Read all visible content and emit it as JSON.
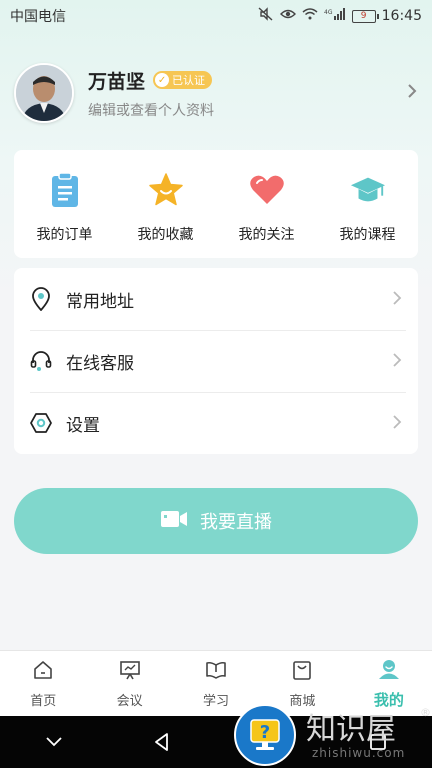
{
  "status_bar": {
    "carrier": "中国电信",
    "network": "4G",
    "battery": "9",
    "time": "16:45"
  },
  "profile": {
    "name": "万苗坚",
    "badge": "已认证",
    "subtitle": "编辑或查看个人资料"
  },
  "quick_actions": [
    {
      "label": "我的订单",
      "icon": "clipboard-icon",
      "color": "#5fb6e6"
    },
    {
      "label": "我的收藏",
      "icon": "star-icon",
      "color": "#f5b327"
    },
    {
      "label": "我的关注",
      "icon": "heart-icon",
      "color": "#f26c6c"
    },
    {
      "label": "我的课程",
      "icon": "graduation-cap-icon",
      "color": "#5ec6c8"
    }
  ],
  "menu": [
    {
      "label": "常用地址",
      "icon": "location-pin-icon"
    },
    {
      "label": "在线客服",
      "icon": "headset-icon"
    },
    {
      "label": "设置",
      "icon": "settings-hexagon-icon"
    }
  ],
  "live_button": {
    "label": "我要直播",
    "icon": "video-camera-icon"
  },
  "tabs": [
    {
      "label": "首页",
      "icon": "home-icon",
      "active": false
    },
    {
      "label": "会议",
      "icon": "presentation-icon",
      "active": false
    },
    {
      "label": "学习",
      "icon": "book-icon",
      "active": false
    },
    {
      "label": "商城",
      "icon": "shopping-bag-icon",
      "active": false
    },
    {
      "label": "我的",
      "icon": "user-icon",
      "active": true
    }
  ],
  "colors": {
    "accent": "#3bbfae",
    "live_button": "#80d7cc",
    "badge": "#f6c653"
  },
  "watermark": {
    "title": "知识屋",
    "subtitle": "zhishiwu.com",
    "mark": "®"
  }
}
